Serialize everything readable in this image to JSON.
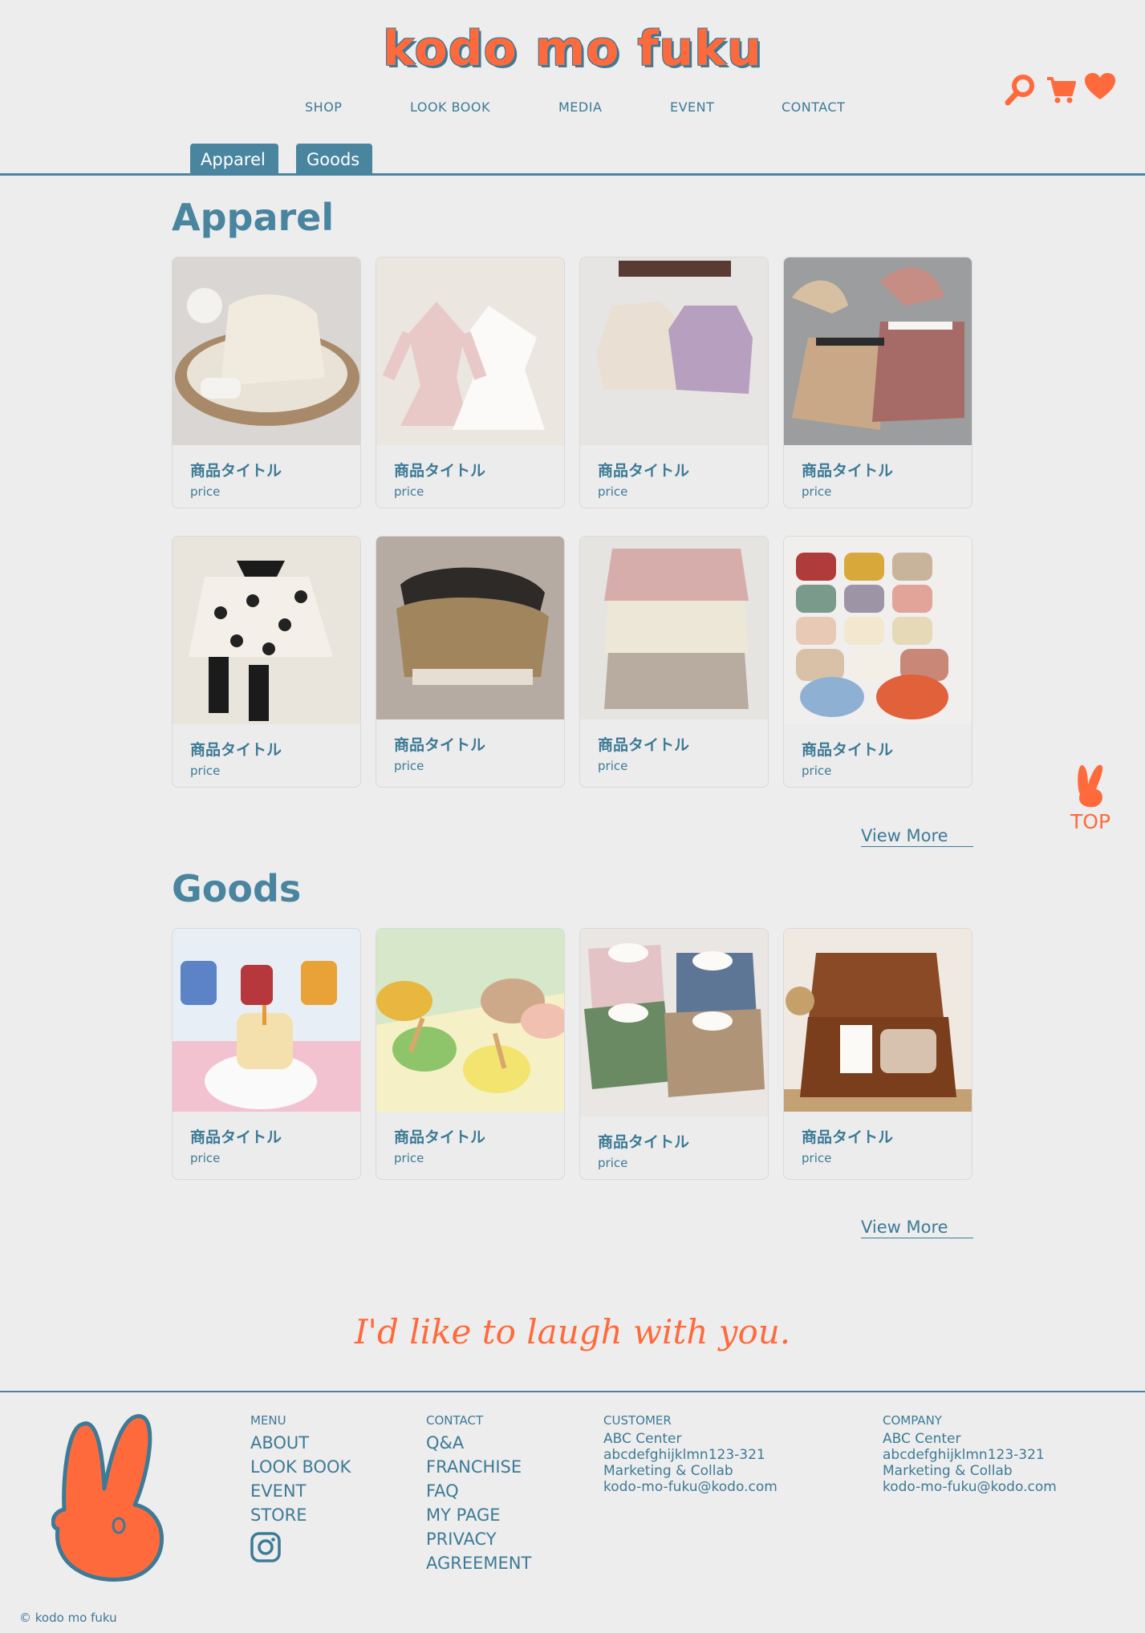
{
  "brand": {
    "logo": "kodo mo fuku",
    "accent": "#ff6a3d",
    "primary": "#3d7a96"
  },
  "nav": [
    {
      "label": "SHOP"
    },
    {
      "label": "LOOK BOOK"
    },
    {
      "label": "MEDIA"
    },
    {
      "label": "EVENT"
    },
    {
      "label": "CONTACT"
    }
  ],
  "header_icons": [
    "search-icon",
    "cart-icon",
    "heart-icon"
  ],
  "tabs": [
    {
      "label": "Apparel"
    },
    {
      "label": "Goods"
    }
  ],
  "apparel": {
    "title": "Apparel",
    "view_more": "View More",
    "items": [
      {
        "title": "商品タイトル",
        "price": "price",
        "image": "ivory lace baby romper in basket"
      },
      {
        "title": "商品タイトル",
        "price": "price",
        "image": "pink and white tutu dresses on hangers"
      },
      {
        "title": "商品タイトル",
        "price": "price",
        "image": "cream and lilac rompers on hook rack"
      },
      {
        "title": "商品タイトル",
        "price": "price",
        "image": "sailor collar rompers with bonnets"
      },
      {
        "title": "商品タイトル",
        "price": "price",
        "image": "cherry print romper with black bow"
      },
      {
        "title": "商品タイトル",
        "price": "price",
        "image": "floral print baby tops"
      },
      {
        "title": "商品タイトル",
        "price": "price",
        "image": "stack of knit cardigans"
      },
      {
        "title": "商品タイトル",
        "price": "price",
        "image": "assorted colored bibs"
      }
    ]
  },
  "goods": {
    "title": "Goods",
    "view_more": "View More",
    "items": [
      {
        "title": "商品タイトル",
        "price": "price",
        "image": "silicone sippy cups"
      },
      {
        "title": "商品タイトル",
        "price": "price",
        "image": "suction bowls with spoons"
      },
      {
        "title": "商品タイトル",
        "price": "price",
        "image": "collared bibs"
      },
      {
        "title": "商品タイトル",
        "price": "price",
        "image": "wicker gift basket set"
      }
    ]
  },
  "to_top": {
    "label": "TOP"
  },
  "tagline": "I'd like to laugh with you.",
  "footer": {
    "menu": {
      "heading": "MENU",
      "links": [
        "ABOUT",
        "LOOK BOOK",
        "EVENT",
        "STORE"
      ]
    },
    "contact": {
      "heading": "CONTACT",
      "links": [
        "Q&A",
        "FRANCHISE",
        "FAQ",
        "MY PAGE",
        "PRIVACY",
        "AGREEMENT"
      ]
    },
    "customer": {
      "heading": "CUSTOMER",
      "lines": [
        "ABC Center",
        "abcdefghijklmn123-321",
        "Marketing & Collab",
        "kodo-mo-fuku@kodo.com"
      ]
    },
    "company": {
      "heading": "COMPANY",
      "lines": [
        "ABC Center",
        "abcdefghijklmn123-321",
        "Marketing & Collab",
        "kodo-mo-fuku@kodo.com"
      ]
    },
    "copyright": "© kodo mo fuku"
  }
}
